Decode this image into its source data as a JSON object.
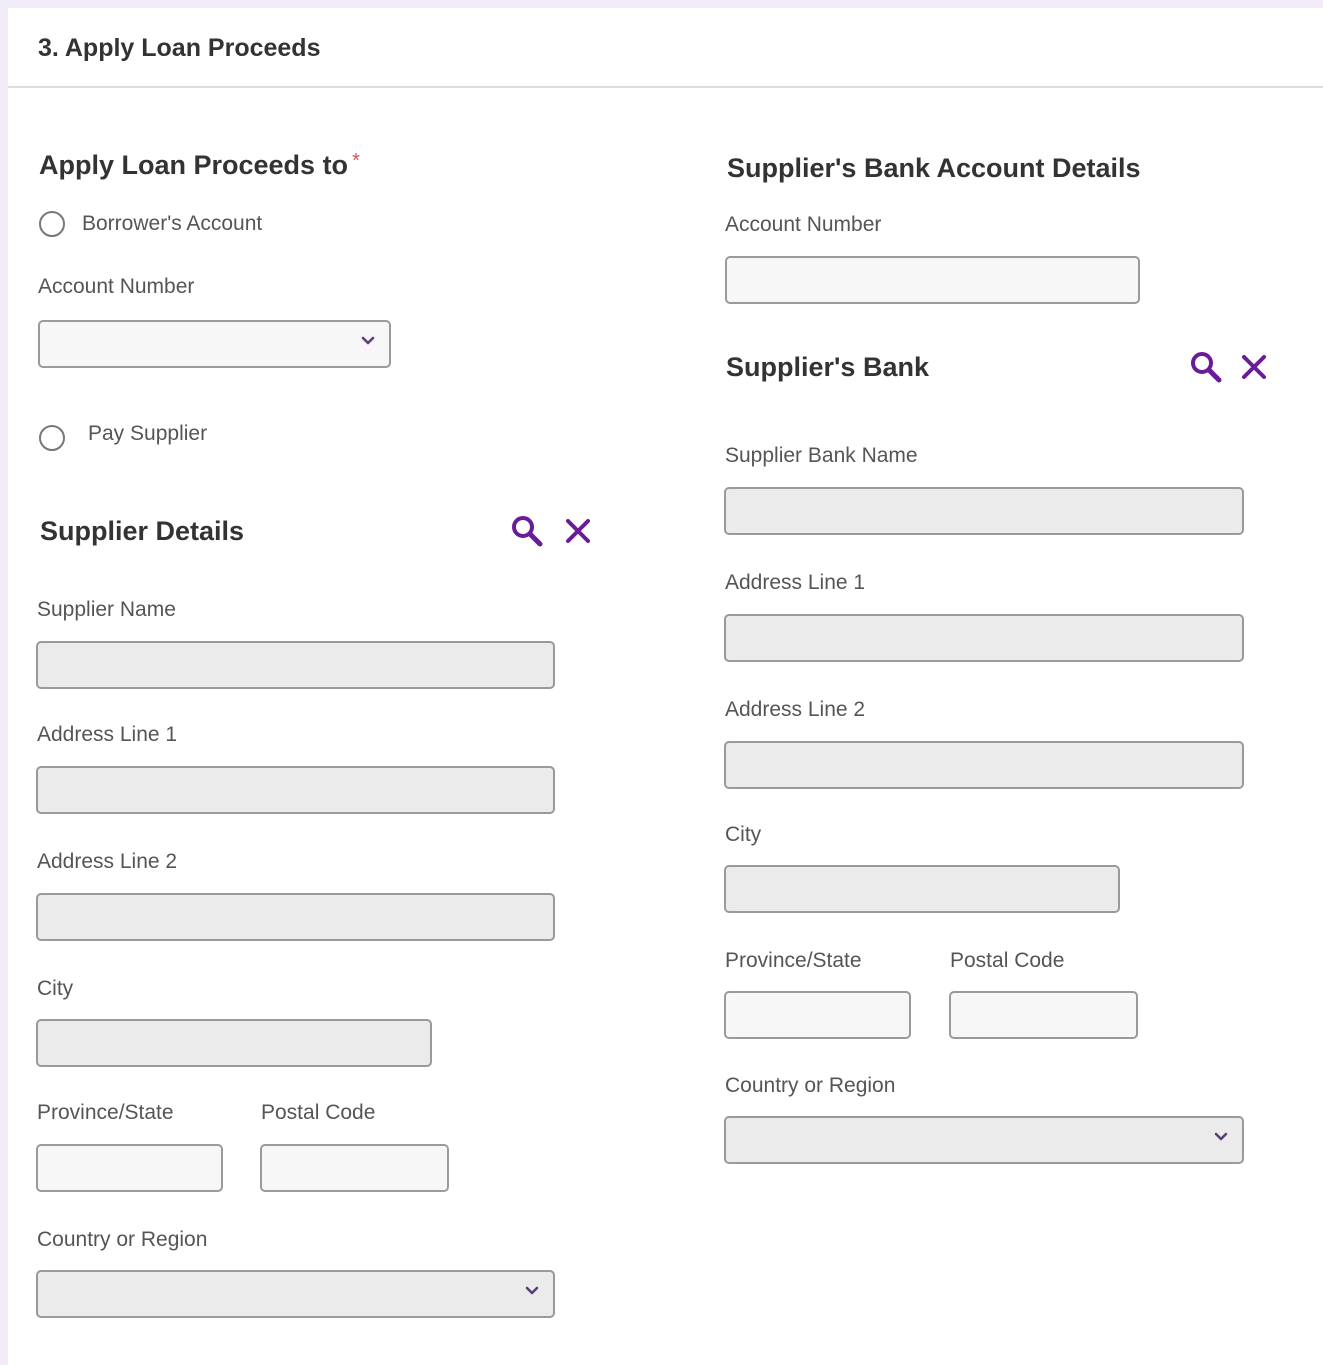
{
  "section": {
    "title": "3. Apply Loan Proceeds"
  },
  "apply_to": {
    "heading": "Apply Loan Proceeds to",
    "required_mark": "*",
    "option_borrower": "Borrower's Account",
    "account_number_label": "Account Number",
    "account_number_value": "",
    "option_pay_supplier": "Pay Supplier"
  },
  "supplier_details": {
    "heading": "Supplier Details",
    "search_icon": "search-icon",
    "clear_icon": "close-icon",
    "name_label": "Supplier Name",
    "address1_label": "Address Line 1",
    "address2_label": "Address Line 2",
    "city_label": "City",
    "province_label": "Province/State",
    "postal_label": "Postal Code",
    "country_label": "Country or Region",
    "values": {
      "name": "",
      "address1": "",
      "address2": "",
      "city": "",
      "province": "",
      "postal": "",
      "country": ""
    }
  },
  "bank_account": {
    "heading": "Supplier's Bank Account Details",
    "account_number_label": "Account Number",
    "account_number_value": ""
  },
  "supplier_bank": {
    "heading": "Supplier's Bank",
    "search_icon": "search-icon",
    "clear_icon": "close-icon",
    "name_label": "Supplier Bank Name",
    "address1_label": "Address Line 1",
    "address2_label": "Address Line 2",
    "city_label": "City",
    "province_label": "Province/State",
    "postal_label": "Postal Code",
    "country_label": "Country or Region",
    "values": {
      "name": "",
      "address1": "",
      "address2": "",
      "city": "",
      "province": "",
      "postal": "",
      "country": ""
    }
  },
  "colors": {
    "accent": "#6a1b9a",
    "required": "#d9534f",
    "field_bg": "#ebebeb",
    "field_border": "#9a9a9a"
  }
}
